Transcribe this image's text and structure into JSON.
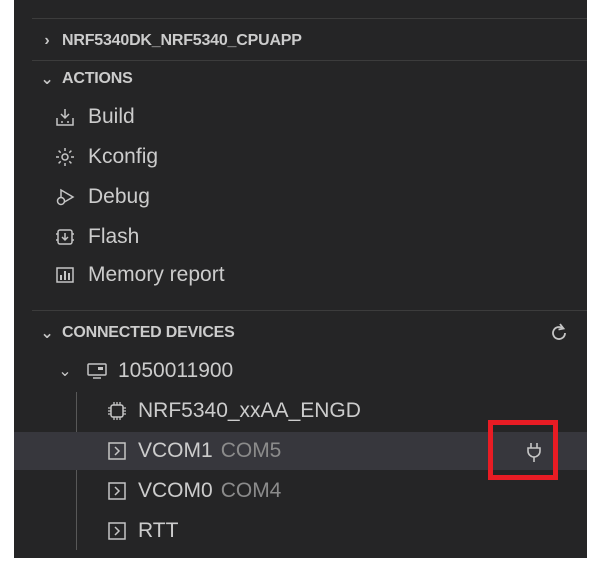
{
  "sections": {
    "board": {
      "label": "NRF5340DK_NRF5340_CPUAPP"
    },
    "actions": {
      "title": "ACTIONS",
      "items": [
        {
          "label": "Build",
          "icon": "build-icon"
        },
        {
          "label": "Kconfig",
          "icon": "gear-icon"
        },
        {
          "label": "Debug",
          "icon": "debug-icon"
        },
        {
          "label": "Flash",
          "icon": "flash-icon"
        },
        {
          "label": "Memory report",
          "icon": "memory-report-icon"
        }
      ]
    },
    "connected_devices": {
      "title": "CONNECTED DEVICES",
      "device": {
        "serial": "1050011900",
        "chip": "NRF5340_xxAA_ENGD",
        "ports": [
          {
            "name": "VCOM1",
            "port": "COM5"
          },
          {
            "name": "VCOM0",
            "port": "COM4"
          },
          {
            "name": "RTT",
            "port": ""
          }
        ]
      }
    }
  },
  "colors": {
    "panel_bg": "#252526",
    "selected_bg": "#37373d",
    "highlight_box": "#e81c24"
  }
}
